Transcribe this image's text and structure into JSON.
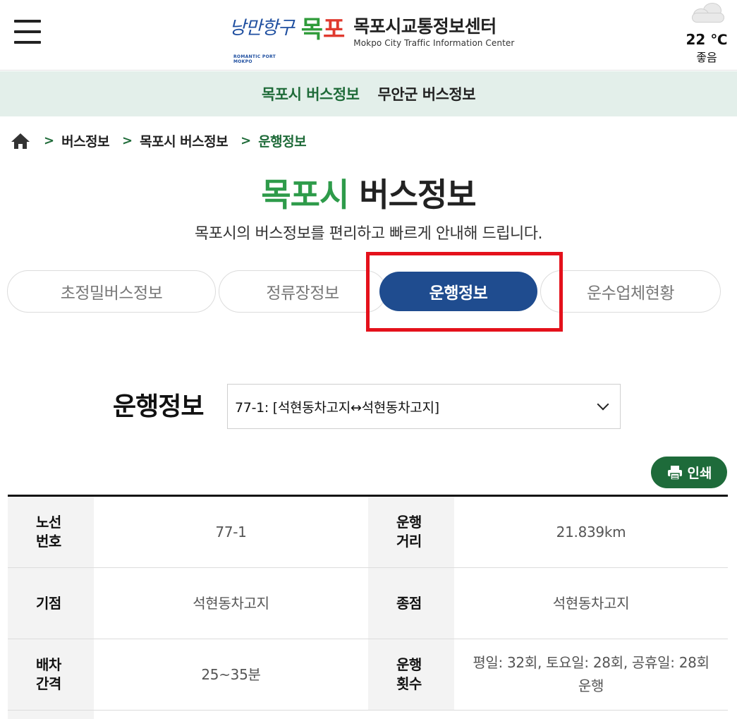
{
  "header": {
    "logo_script": "낭만항구",
    "logo_script_sub": "ROMANTIC PORT MOKPO",
    "logo_mokpo": "목포",
    "logo_title": "목포시교통정보센터",
    "logo_en": "Mokpo City Traffic Information Center",
    "weather_temp": "22 ℃",
    "weather_state": "좋음",
    "weather_icon": "cloud-icon"
  },
  "subnav": [
    {
      "label": "목포시 버스정보",
      "active": true
    },
    {
      "label": "무안군 버스정보",
      "active": false
    }
  ],
  "breadcrumb": [
    "버스정보",
    "목포시 버스정보",
    "운행정보"
  ],
  "page": {
    "title_accent": "목포시",
    "title_rest": "버스정보",
    "description": "목포시의 버스정보를 편리하고 빠르게 안내해 드립니다."
  },
  "tabs": [
    "초정밀버스정보",
    "정류장정보",
    "운행정보",
    "운수업체현황"
  ],
  "active_tab": "운행정보",
  "route": {
    "label": "운행정보",
    "selected": "77-1: [석현동차고지↔석현동차고지]"
  },
  "print_label": "인쇄",
  "info": {
    "rows": [
      {
        "h1": "노선\n번호",
        "v1": "77-1",
        "h2": "운행\n거리",
        "v2": "21.839km"
      },
      {
        "h1": "기점",
        "v1": "석현동차고지",
        "h2": "종점",
        "v2": "석현동차고지"
      },
      {
        "h1": "배차\n간격",
        "v1": "25~35분",
        "h2": "운행\n횟수",
        "v2": "평일: 32회, 토요일: 28회, 공휴일: 28회 운행"
      }
    ]
  },
  "colors": {
    "accent_green": "#2e9b4a",
    "dark_green": "#1e6b3a",
    "active_tab_blue": "#1f4c8f",
    "highlight_red": "#e4111b",
    "subnav_bg": "#e3efea"
  }
}
